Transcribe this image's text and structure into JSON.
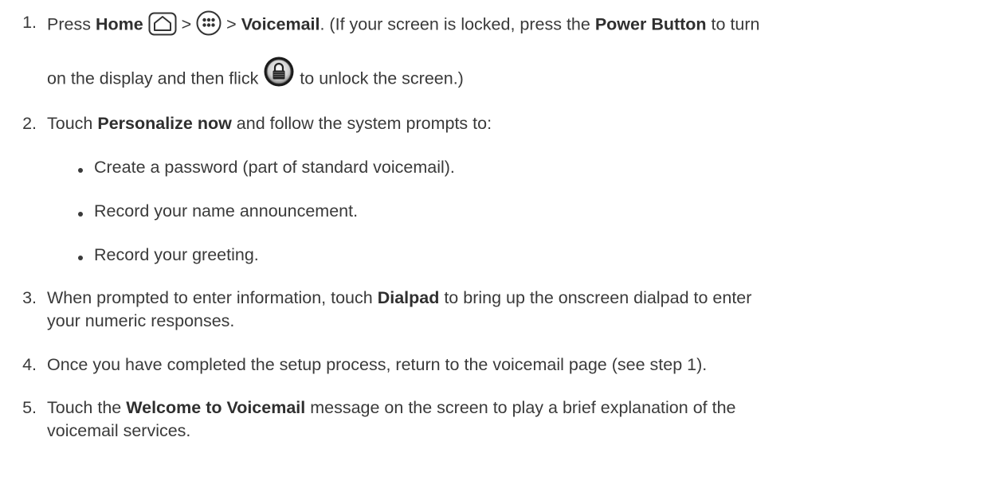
{
  "steps": [
    {
      "number": "1.",
      "line1": {
        "t1": "Press ",
        "b1": "Home",
        "t2": " > ",
        "t3": " > ",
        "b2": "Voicemail",
        "t4": ". (If your screen is locked, press the ",
        "b3": "Power Button",
        "t5": " to turn"
      },
      "line2": {
        "t1": "on the display and then flick ",
        "t2": " to unlock the screen.)"
      }
    },
    {
      "number": "2.",
      "t1": "Touch ",
      "b1": "Personalize now",
      "t2": " and follow the system prompts to:",
      "bullets": [
        "Create a password (part of standard voicemail).",
        "Record your name announcement.",
        "Record your greeting."
      ]
    },
    {
      "number": "3.",
      "t1": "When prompted to enter information, touch ",
      "b1": "Dialpad",
      "t2": " to bring up the onscreen dialpad to enter",
      "line2": "your numeric responses."
    },
    {
      "number": "4.",
      "t1": "Once you have completed the setup process, return to the voicemail page (see step 1)."
    },
    {
      "number": "5.",
      "t1": "Touch the ",
      "b1": "Welcome to Voicemail",
      "t2": " message on the screen to play a brief explanation of the",
      "line2": "voicemail services."
    }
  ],
  "icons": [
    "home-icon",
    "apps-icon",
    "lock-icon"
  ]
}
